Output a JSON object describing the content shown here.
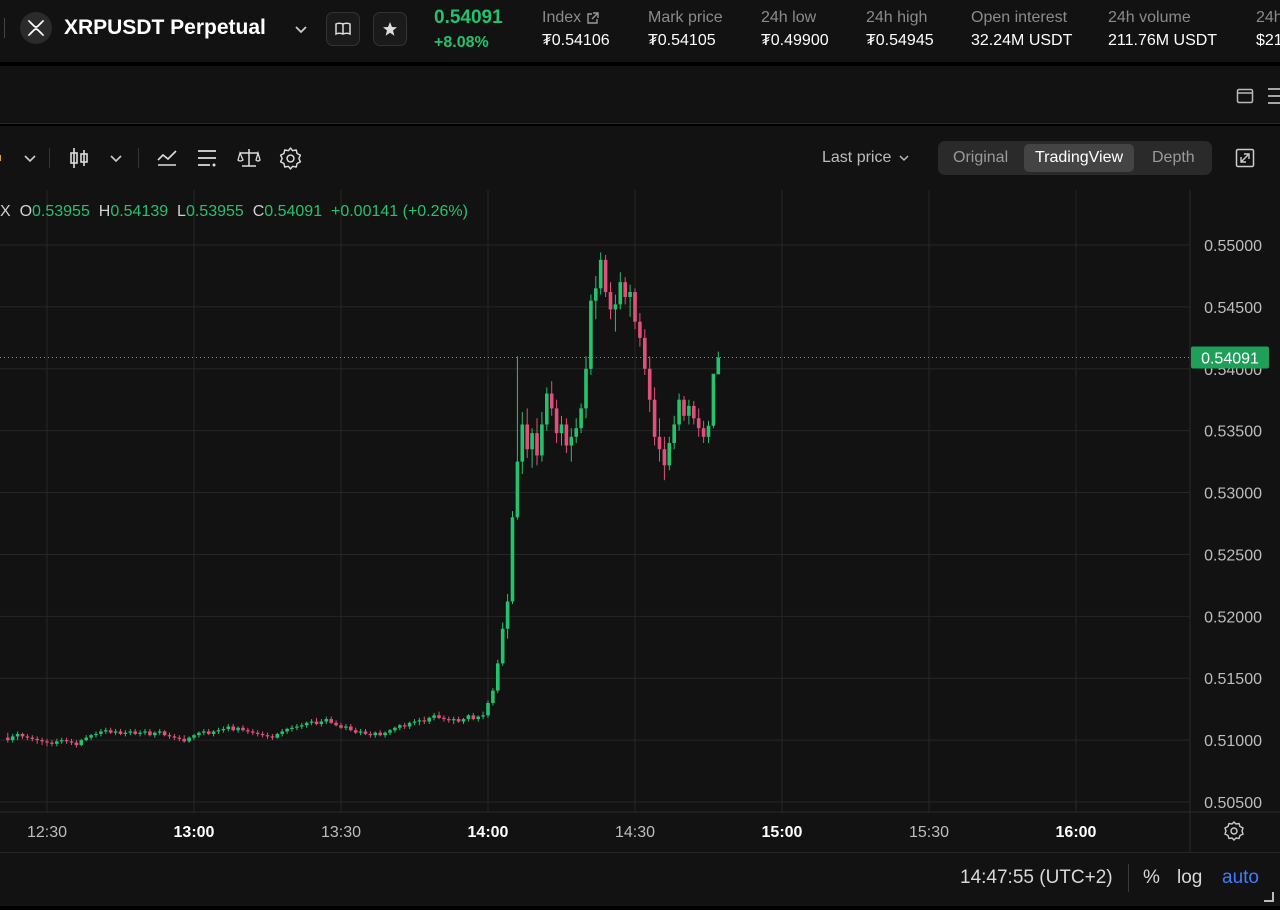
{
  "header": {
    "symbol": "XRPUSDT Perpetual",
    "last_price": "0.54091",
    "change_pct": "+8.08%",
    "stats": [
      {
        "label": "Index",
        "value": "₮0.54106"
      },
      {
        "label": "Mark price",
        "value": "₮0.54105"
      },
      {
        "label": "24h low",
        "value": "₮0.49900"
      },
      {
        "label": "24h high",
        "value": "₮0.54945"
      },
      {
        "label": "Open interest",
        "value": "32.24M USDT"
      },
      {
        "label": "24h volume",
        "value": "211.76M USDT"
      },
      {
        "label": "24h",
        "value": "$21"
      }
    ]
  },
  "toolbar": {
    "price_type": "Last price",
    "views": [
      "Original",
      "TradingView",
      "Depth"
    ],
    "active_view": "TradingView"
  },
  "legend": {
    "prefix": "X",
    "o_label": "O",
    "o": "0.53955",
    "h_label": "H",
    "h": "0.54139",
    "l_label": "L",
    "l": "0.53955",
    "c_label": "C",
    "c": "0.54091",
    "change": "+0.00141 (+0.26%)"
  },
  "chart_data": {
    "type": "candlestick",
    "x_ticks": [
      "12:30",
      "13:00",
      "13:30",
      "14:00",
      "14:30",
      "15:00",
      "15:30",
      "16:00"
    ],
    "bold_x_ticks": [
      "13:00",
      "14:00",
      "15:00",
      "16:00"
    ],
    "y_ticks": [
      "0.55000",
      "0.54500",
      "0.54000",
      "0.53500",
      "0.53000",
      "0.52500",
      "0.52000",
      "0.51500",
      "0.51000",
      "0.50500"
    ],
    "ylim": [
      0.505,
      0.55
    ],
    "current_price": "0.54091",
    "grid": true,
    "up_color": "#25c26e",
    "down_color": "#e0507a",
    "candles": [
      {
        "t": "12:22",
        "o": 0.5102,
        "h": 0.5106,
        "l": 0.5098,
        "c": 0.51
      },
      {
        "t": "12:23",
        "o": 0.51,
        "h": 0.5105,
        "l": 0.5098,
        "c": 0.5103
      },
      {
        "t": "12:24",
        "o": 0.5103,
        "h": 0.5107,
        "l": 0.51,
        "c": 0.5105
      },
      {
        "t": "12:25",
        "o": 0.5105,
        "h": 0.5106,
        "l": 0.5101,
        "c": 0.5103
      },
      {
        "t": "12:26",
        "o": 0.5103,
        "h": 0.5105,
        "l": 0.51,
        "c": 0.5102
      },
      {
        "t": "12:27",
        "o": 0.5102,
        "h": 0.5104,
        "l": 0.5099,
        "c": 0.5101
      },
      {
        "t": "12:28",
        "o": 0.5101,
        "h": 0.5103,
        "l": 0.5097,
        "c": 0.51
      },
      {
        "t": "12:29",
        "o": 0.51,
        "h": 0.5102,
        "l": 0.5096,
        "c": 0.5099
      },
      {
        "t": "12:30",
        "o": 0.5099,
        "h": 0.5101,
        "l": 0.5095,
        "c": 0.5098
      },
      {
        "t": "12:31",
        "o": 0.5098,
        "h": 0.51,
        "l": 0.5095,
        "c": 0.5097
      },
      {
        "t": "12:32",
        "o": 0.5097,
        "h": 0.5101,
        "l": 0.5095,
        "c": 0.5099
      },
      {
        "t": "12:33",
        "o": 0.5099,
        "h": 0.5102,
        "l": 0.5097,
        "c": 0.51
      },
      {
        "t": "12:34",
        "o": 0.51,
        "h": 0.5102,
        "l": 0.5097,
        "c": 0.5099
      },
      {
        "t": "12:35",
        "o": 0.5099,
        "h": 0.5101,
        "l": 0.5096,
        "c": 0.5098
      },
      {
        "t": "12:36",
        "o": 0.5098,
        "h": 0.51,
        "l": 0.5094,
        "c": 0.5096
      },
      {
        "t": "12:37",
        "o": 0.5096,
        "h": 0.5101,
        "l": 0.5095,
        "c": 0.51
      },
      {
        "t": "12:38",
        "o": 0.51,
        "h": 0.5104,
        "l": 0.5099,
        "c": 0.5102
      },
      {
        "t": "12:39",
        "o": 0.5102,
        "h": 0.5105,
        "l": 0.51,
        "c": 0.5104
      },
      {
        "t": "12:40",
        "o": 0.5104,
        "h": 0.5107,
        "l": 0.5102,
        "c": 0.5105
      },
      {
        "t": "12:41",
        "o": 0.5105,
        "h": 0.5109,
        "l": 0.5103,
        "c": 0.5107
      },
      {
        "t": "12:42",
        "o": 0.5107,
        "h": 0.511,
        "l": 0.5105,
        "c": 0.5108
      },
      {
        "t": "12:43",
        "o": 0.5108,
        "h": 0.511,
        "l": 0.5105,
        "c": 0.5106
      },
      {
        "t": "12:44",
        "o": 0.5106,
        "h": 0.5109,
        "l": 0.5104,
        "c": 0.5107
      },
      {
        "t": "12:45",
        "o": 0.5107,
        "h": 0.5109,
        "l": 0.5104,
        "c": 0.5105
      },
      {
        "t": "12:46",
        "o": 0.5105,
        "h": 0.5108,
        "l": 0.5103,
        "c": 0.5106
      },
      {
        "t": "12:47",
        "o": 0.5106,
        "h": 0.5109,
        "l": 0.5104,
        "c": 0.5107
      },
      {
        "t": "12:48",
        "o": 0.5107,
        "h": 0.5109,
        "l": 0.5104,
        "c": 0.5105
      },
      {
        "t": "12:49",
        "o": 0.5105,
        "h": 0.5108,
        "l": 0.5103,
        "c": 0.5106
      },
      {
        "t": "12:50",
        "o": 0.5106,
        "h": 0.5109,
        "l": 0.5104,
        "c": 0.5107
      },
      {
        "t": "12:51",
        "o": 0.5107,
        "h": 0.5109,
        "l": 0.5103,
        "c": 0.5104
      },
      {
        "t": "12:52",
        "o": 0.5104,
        "h": 0.5107,
        "l": 0.5102,
        "c": 0.5106
      },
      {
        "t": "12:53",
        "o": 0.5106,
        "h": 0.5109,
        "l": 0.5104,
        "c": 0.5107
      },
      {
        "t": "12:54",
        "o": 0.5107,
        "h": 0.5108,
        "l": 0.5103,
        "c": 0.5104
      },
      {
        "t": "12:55",
        "o": 0.5104,
        "h": 0.5106,
        "l": 0.5101,
        "c": 0.5103
      },
      {
        "t": "12:56",
        "o": 0.5103,
        "h": 0.5105,
        "l": 0.51,
        "c": 0.5102
      },
      {
        "t": "12:57",
        "o": 0.5102,
        "h": 0.5104,
        "l": 0.5099,
        "c": 0.5101
      },
      {
        "t": "12:58",
        "o": 0.5101,
        "h": 0.5104,
        "l": 0.5098,
        "c": 0.5099
      },
      {
        "t": "12:59",
        "o": 0.5099,
        "h": 0.5103,
        "l": 0.5098,
        "c": 0.5102
      },
      {
        "t": "13:00",
        "o": 0.5102,
        "h": 0.5105,
        "l": 0.51,
        "c": 0.5104
      },
      {
        "t": "13:01",
        "o": 0.5104,
        "h": 0.5107,
        "l": 0.5102,
        "c": 0.5106
      },
      {
        "t": "13:02",
        "o": 0.5106,
        "h": 0.5109,
        "l": 0.5104,
        "c": 0.5107
      },
      {
        "t": "13:03",
        "o": 0.5107,
        "h": 0.5109,
        "l": 0.5104,
        "c": 0.5105
      },
      {
        "t": "13:04",
        "o": 0.5105,
        "h": 0.5108,
        "l": 0.5103,
        "c": 0.5107
      },
      {
        "t": "13:05",
        "o": 0.5107,
        "h": 0.511,
        "l": 0.5105,
        "c": 0.5108
      },
      {
        "t": "13:06",
        "o": 0.5108,
        "h": 0.5111,
        "l": 0.5106,
        "c": 0.5109
      },
      {
        "t": "13:07",
        "o": 0.5109,
        "h": 0.5113,
        "l": 0.5107,
        "c": 0.5111
      },
      {
        "t": "13:08",
        "o": 0.5111,
        "h": 0.5113,
        "l": 0.5107,
        "c": 0.5108
      },
      {
        "t": "13:09",
        "o": 0.5108,
        "h": 0.5111,
        "l": 0.5106,
        "c": 0.511
      },
      {
        "t": "13:10",
        "o": 0.511,
        "h": 0.5112,
        "l": 0.5107,
        "c": 0.5108
      },
      {
        "t": "13:11",
        "o": 0.5108,
        "h": 0.511,
        "l": 0.5105,
        "c": 0.5107
      },
      {
        "t": "13:12",
        "o": 0.5107,
        "h": 0.5109,
        "l": 0.5104,
        "c": 0.5106
      },
      {
        "t": "13:13",
        "o": 0.5106,
        "h": 0.5108,
        "l": 0.5103,
        "c": 0.5105
      },
      {
        "t": "13:14",
        "o": 0.5105,
        "h": 0.5107,
        "l": 0.5102,
        "c": 0.5104
      },
      {
        "t": "13:15",
        "o": 0.5104,
        "h": 0.5106,
        "l": 0.5101,
        "c": 0.5103
      },
      {
        "t": "13:16",
        "o": 0.5103,
        "h": 0.5105,
        "l": 0.51,
        "c": 0.5102
      },
      {
        "t": "13:17",
        "o": 0.5102,
        "h": 0.5106,
        "l": 0.5101,
        "c": 0.5105
      },
      {
        "t": "13:18",
        "o": 0.5105,
        "h": 0.5109,
        "l": 0.5103,
        "c": 0.5107
      },
      {
        "t": "13:19",
        "o": 0.5107,
        "h": 0.511,
        "l": 0.5105,
        "c": 0.5109
      },
      {
        "t": "13:20",
        "o": 0.5109,
        "h": 0.5112,
        "l": 0.5107,
        "c": 0.511
      },
      {
        "t": "13:21",
        "o": 0.511,
        "h": 0.5113,
        "l": 0.5108,
        "c": 0.5111
      },
      {
        "t": "13:22",
        "o": 0.5111,
        "h": 0.5114,
        "l": 0.5109,
        "c": 0.5112
      },
      {
        "t": "13:23",
        "o": 0.5112,
        "h": 0.5115,
        "l": 0.511,
        "c": 0.5114
      },
      {
        "t": "13:24",
        "o": 0.5114,
        "h": 0.5117,
        "l": 0.5112,
        "c": 0.5115
      },
      {
        "t": "13:25",
        "o": 0.5115,
        "h": 0.5118,
        "l": 0.5112,
        "c": 0.5113
      },
      {
        "t": "13:26",
        "o": 0.5113,
        "h": 0.5117,
        "l": 0.5111,
        "c": 0.5115
      },
      {
        "t": "13:27",
        "o": 0.5115,
        "h": 0.5119,
        "l": 0.5113,
        "c": 0.5117
      },
      {
        "t": "13:28",
        "o": 0.5117,
        "h": 0.5119,
        "l": 0.5113,
        "c": 0.5114
      },
      {
        "t": "13:29",
        "o": 0.5114,
        "h": 0.5116,
        "l": 0.5111,
        "c": 0.5112
      },
      {
        "t": "13:30",
        "o": 0.5112,
        "h": 0.5114,
        "l": 0.5109,
        "c": 0.511
      },
      {
        "t": "13:31",
        "o": 0.511,
        "h": 0.5113,
        "l": 0.5108,
        "c": 0.5111
      },
      {
        "t": "13:32",
        "o": 0.5111,
        "h": 0.5113,
        "l": 0.5107,
        "c": 0.5108
      },
      {
        "t": "13:33",
        "o": 0.5108,
        "h": 0.511,
        "l": 0.5105,
        "c": 0.5106
      },
      {
        "t": "13:34",
        "o": 0.5106,
        "h": 0.5109,
        "l": 0.5104,
        "c": 0.5107
      },
      {
        "t": "13:35",
        "o": 0.5107,
        "h": 0.5109,
        "l": 0.5104,
        "c": 0.5105
      },
      {
        "t": "13:36",
        "o": 0.5105,
        "h": 0.5107,
        "l": 0.5102,
        "c": 0.5104
      },
      {
        "t": "13:37",
        "o": 0.5104,
        "h": 0.5107,
        "l": 0.5102,
        "c": 0.5106
      },
      {
        "t": "13:38",
        "o": 0.5106,
        "h": 0.5108,
        "l": 0.5103,
        "c": 0.5104
      },
      {
        "t": "13:39",
        "o": 0.5104,
        "h": 0.5107,
        "l": 0.5102,
        "c": 0.5106
      },
      {
        "t": "13:40",
        "o": 0.5106,
        "h": 0.5109,
        "l": 0.5104,
        "c": 0.5108
      },
      {
        "t": "13:41",
        "o": 0.5108,
        "h": 0.5111,
        "l": 0.5106,
        "c": 0.511
      },
      {
        "t": "13:42",
        "o": 0.511,
        "h": 0.5113,
        "l": 0.5108,
        "c": 0.5112
      },
      {
        "t": "13:43",
        "o": 0.5112,
        "h": 0.5114,
        "l": 0.5109,
        "c": 0.5111
      },
      {
        "t": "13:44",
        "o": 0.5111,
        "h": 0.5115,
        "l": 0.5109,
        "c": 0.5114
      },
      {
        "t": "13:45",
        "o": 0.5114,
        "h": 0.5117,
        "l": 0.5112,
        "c": 0.5115
      },
      {
        "t": "13:46",
        "o": 0.5115,
        "h": 0.5118,
        "l": 0.5112,
        "c": 0.5116
      },
      {
        "t": "13:47",
        "o": 0.5116,
        "h": 0.5119,
        "l": 0.5113,
        "c": 0.5115
      },
      {
        "t": "13:48",
        "o": 0.5115,
        "h": 0.5119,
        "l": 0.5113,
        "c": 0.5118
      },
      {
        "t": "13:49",
        "o": 0.5118,
        "h": 0.5122,
        "l": 0.5116,
        "c": 0.512
      },
      {
        "t": "13:50",
        "o": 0.512,
        "h": 0.5123,
        "l": 0.5117,
        "c": 0.5118
      },
      {
        "t": "13:51",
        "o": 0.5118,
        "h": 0.512,
        "l": 0.5115,
        "c": 0.5117
      },
      {
        "t": "13:52",
        "o": 0.5117,
        "h": 0.5119,
        "l": 0.5114,
        "c": 0.5116
      },
      {
        "t": "13:53",
        "o": 0.5116,
        "h": 0.5119,
        "l": 0.5113,
        "c": 0.5117
      },
      {
        "t": "13:54",
        "o": 0.5117,
        "h": 0.5119,
        "l": 0.5114,
        "c": 0.5115
      },
      {
        "t": "13:55",
        "o": 0.5115,
        "h": 0.5118,
        "l": 0.5113,
        "c": 0.5117
      },
      {
        "t": "13:56",
        "o": 0.5117,
        "h": 0.5121,
        "l": 0.5115,
        "c": 0.512
      },
      {
        "t": "13:57",
        "o": 0.512,
        "h": 0.5122,
        "l": 0.5116,
        "c": 0.5117
      },
      {
        "t": "13:58",
        "o": 0.5117,
        "h": 0.512,
        "l": 0.5115,
        "c": 0.5119
      },
      {
        "t": "13:59",
        "o": 0.5119,
        "h": 0.5123,
        "l": 0.5117,
        "c": 0.512
      },
      {
        "t": "14:00",
        "o": 0.512,
        "h": 0.5132,
        "l": 0.5118,
        "c": 0.513
      },
      {
        "t": "14:01",
        "o": 0.513,
        "h": 0.5142,
        "l": 0.5128,
        "c": 0.514
      },
      {
        "t": "14:02",
        "o": 0.514,
        "h": 0.5165,
        "l": 0.5138,
        "c": 0.5162
      },
      {
        "t": "14:03",
        "o": 0.5162,
        "h": 0.5195,
        "l": 0.516,
        "c": 0.519
      },
      {
        "t": "14:04",
        "o": 0.519,
        "h": 0.5218,
        "l": 0.5182,
        "c": 0.5212
      },
      {
        "t": "14:05",
        "o": 0.5212,
        "h": 0.5285,
        "l": 0.521,
        "c": 0.528
      },
      {
        "t": "14:06",
        "o": 0.528,
        "h": 0.541,
        "l": 0.5278,
        "c": 0.5325
      },
      {
        "t": "14:07",
        "o": 0.5325,
        "h": 0.5365,
        "l": 0.5315,
        "c": 0.5355
      },
      {
        "t": "14:08",
        "o": 0.5355,
        "h": 0.5368,
        "l": 0.5328,
        "c": 0.5335
      },
      {
        "t": "14:09",
        "o": 0.5335,
        "h": 0.5352,
        "l": 0.532,
        "c": 0.5348
      },
      {
        "t": "14:10",
        "o": 0.5348,
        "h": 0.536,
        "l": 0.5322,
        "c": 0.533
      },
      {
        "t": "14:11",
        "o": 0.533,
        "h": 0.5365,
        "l": 0.5325,
        "c": 0.5355
      },
      {
        "t": "14:12",
        "o": 0.5355,
        "h": 0.5385,
        "l": 0.535,
        "c": 0.538
      },
      {
        "t": "14:13",
        "o": 0.538,
        "h": 0.539,
        "l": 0.5362,
        "c": 0.5368
      },
      {
        "t": "14:14",
        "o": 0.5368,
        "h": 0.5375,
        "l": 0.534,
        "c": 0.5348
      },
      {
        "t": "14:15",
        "o": 0.5348,
        "h": 0.5362,
        "l": 0.5338,
        "c": 0.5355
      },
      {
        "t": "14:16",
        "o": 0.5355,
        "h": 0.536,
        "l": 0.5332,
        "c": 0.5338
      },
      {
        "t": "14:17",
        "o": 0.5338,
        "h": 0.5352,
        "l": 0.5325,
        "c": 0.5345
      },
      {
        "t": "14:18",
        "o": 0.5345,
        "h": 0.536,
        "l": 0.534,
        "c": 0.5352
      },
      {
        "t": "14:19",
        "o": 0.5352,
        "h": 0.5372,
        "l": 0.5348,
        "c": 0.5368
      },
      {
        "t": "14:20",
        "o": 0.5368,
        "h": 0.541,
        "l": 0.536,
        "c": 0.54
      },
      {
        "t": "14:21",
        "o": 0.54,
        "h": 0.546,
        "l": 0.5395,
        "c": 0.5455
      },
      {
        "t": "14:22",
        "o": 0.5455,
        "h": 0.5475,
        "l": 0.544,
        "c": 0.5465
      },
      {
        "t": "14:23",
        "o": 0.5465,
        "h": 0.5494,
        "l": 0.546,
        "c": 0.5488
      },
      {
        "t": "14:24",
        "o": 0.5488,
        "h": 0.5492,
        "l": 0.5458,
        "c": 0.5462
      },
      {
        "t": "14:25",
        "o": 0.5462,
        "h": 0.547,
        "l": 0.544,
        "c": 0.5448
      },
      {
        "t": "14:26",
        "o": 0.5448,
        "h": 0.546,
        "l": 0.543,
        "c": 0.5452
      },
      {
        "t": "14:27",
        "o": 0.5452,
        "h": 0.5478,
        "l": 0.5448,
        "c": 0.547
      },
      {
        "t": "14:28",
        "o": 0.547,
        "h": 0.5474,
        "l": 0.5452,
        "c": 0.5458
      },
      {
        "t": "14:29",
        "o": 0.5458,
        "h": 0.5468,
        "l": 0.5442,
        "c": 0.5462
      },
      {
        "t": "14:30",
        "o": 0.5462,
        "h": 0.5465,
        "l": 0.5432,
        "c": 0.5438
      },
      {
        "t": "14:31",
        "o": 0.5438,
        "h": 0.5445,
        "l": 0.5418,
        "c": 0.5425
      },
      {
        "t": "14:32",
        "o": 0.5425,
        "h": 0.5432,
        "l": 0.5395,
        "c": 0.54
      },
      {
        "t": "14:33",
        "o": 0.54,
        "h": 0.541,
        "l": 0.5365,
        "c": 0.5375
      },
      {
        "t": "14:34",
        "o": 0.5375,
        "h": 0.5385,
        "l": 0.5338,
        "c": 0.5345
      },
      {
        "t": "14:35",
        "o": 0.5345,
        "h": 0.536,
        "l": 0.5325,
        "c": 0.5335
      },
      {
        "t": "14:36",
        "o": 0.5335,
        "h": 0.5345,
        "l": 0.531,
        "c": 0.5322
      },
      {
        "t": "14:37",
        "o": 0.5322,
        "h": 0.5345,
        "l": 0.5318,
        "c": 0.534
      },
      {
        "t": "14:38",
        "o": 0.534,
        "h": 0.5362,
        "l": 0.5335,
        "c": 0.5355
      },
      {
        "t": "14:39",
        "o": 0.5355,
        "h": 0.538,
        "l": 0.535,
        "c": 0.5375
      },
      {
        "t": "14:40",
        "o": 0.5375,
        "h": 0.5378,
        "l": 0.5358,
        "c": 0.5362
      },
      {
        "t": "14:41",
        "o": 0.5362,
        "h": 0.5375,
        "l": 0.5355,
        "c": 0.537
      },
      {
        "t": "14:42",
        "o": 0.537,
        "h": 0.5374,
        "l": 0.5355,
        "c": 0.536
      },
      {
        "t": "14:43",
        "o": 0.536,
        "h": 0.5368,
        "l": 0.5345,
        "c": 0.5352
      },
      {
        "t": "14:44",
        "o": 0.5352,
        "h": 0.5358,
        "l": 0.534,
        "c": 0.5345
      },
      {
        "t": "14:45",
        "o": 0.5345,
        "h": 0.5358,
        "l": 0.534,
        "c": 0.5354
      },
      {
        "t": "14:46",
        "o": 0.5354,
        "h": 0.5385,
        "l": 0.5352,
        "c": 0.5396
      },
      {
        "t": "14:47",
        "o": 0.53955,
        "h": 0.54139,
        "l": 0.53955,
        "c": 0.54091
      }
    ]
  },
  "footer": {
    "clock": "14:47:55 (UTC+2)",
    "percent": "%",
    "log": "log",
    "auto": "auto"
  }
}
